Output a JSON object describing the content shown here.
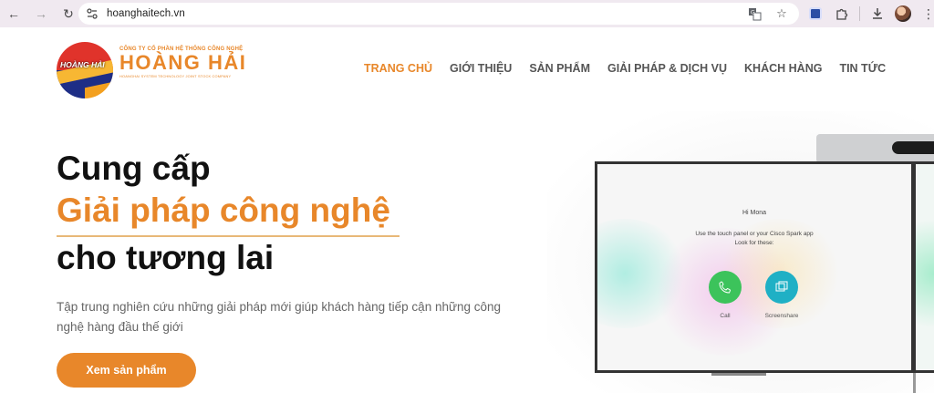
{
  "browser": {
    "url": "hoanghaitech.vn"
  },
  "logo": {
    "badge": "HOÀNG HẢI",
    "company_small": "CÔNG TY CỔ PHẦN HỆ THỐNG CÔNG NGHỆ",
    "company_name": "HOÀNG HẢI",
    "company_english": "HOANGHAI SYSTEM TECHNOLOGY JOINT STOCK COMPANY"
  },
  "nav": {
    "items": [
      {
        "label": "TRANG CHỦ",
        "active": true
      },
      {
        "label": "GIỚI THIỆU",
        "active": false
      },
      {
        "label": "SẢN PHẨM",
        "active": false
      },
      {
        "label": "GIẢI PHÁP & DỊCH VỤ",
        "active": false
      },
      {
        "label": "KHÁCH HÀNG",
        "active": false
      },
      {
        "label": "TIN TỨC",
        "active": false
      }
    ]
  },
  "hero": {
    "line1": "Cung cấp",
    "line2": "Giải pháp công nghệ",
    "line3": "cho tương lai",
    "description": "Tập trung nghiên cứu những giải pháp mới giúp khách hàng tiếp cận những công nghệ hàng đầu thế giới",
    "cta": "Xem sản phẩm"
  },
  "device_screen": {
    "greeting": "Hi Mona",
    "instruction_line1": "Use the touch panel or your Cisco Spark app",
    "instruction_line2": "Look for these:",
    "call_label": "Call",
    "share_label": "Screenshare"
  },
  "colors": {
    "accent": "#e8872a",
    "browser_bar": "#f0e9f0",
    "call_green": "#3cc35b",
    "share_teal": "#1fb0c5"
  }
}
